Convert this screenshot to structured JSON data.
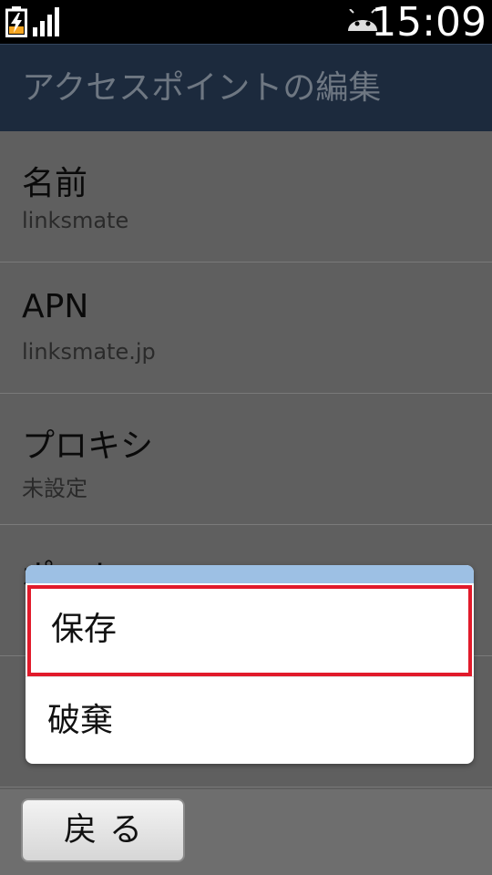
{
  "status_bar": {
    "time": "15:09",
    "icons": [
      "battery-charging-icon",
      "signal-icon",
      "android-icon"
    ]
  },
  "title_bar": {
    "title": "アクセスポイントの編集"
  },
  "settings": {
    "items": [
      {
        "title": "名前",
        "value": "linksmate"
      },
      {
        "title": "APN",
        "value": "linksmate.jp"
      },
      {
        "title": "プロキシ",
        "value": "未設定"
      },
      {
        "title": "ポート",
        "value": ""
      },
      {
        "title": "",
        "value": ""
      }
    ]
  },
  "menu": {
    "items": [
      {
        "label": "保存",
        "highlighted": true
      },
      {
        "label": "破棄",
        "highlighted": false
      }
    ]
  },
  "bottom_bar": {
    "back_label": "戻る"
  },
  "colors": {
    "title_bar_bg": "#1c2a3d",
    "menu_header": "#9dc0e4",
    "highlight_border": "#e11a2b",
    "list_bg": "#5f5f5f"
  }
}
